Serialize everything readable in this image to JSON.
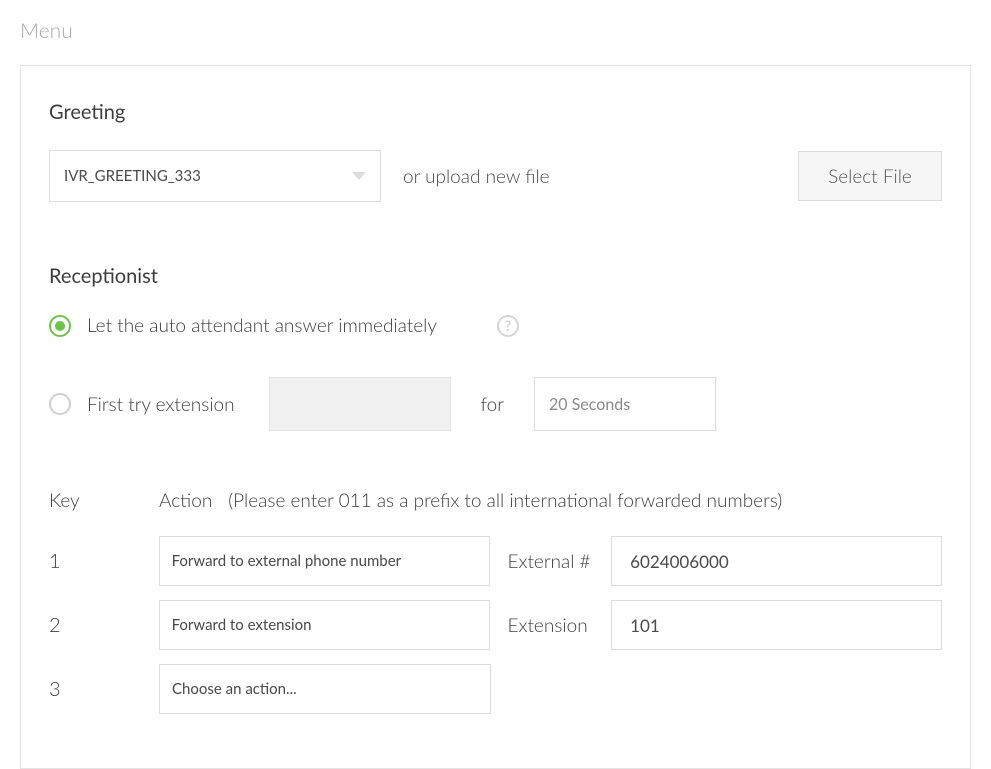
{
  "page_title": "Menu",
  "greeting": {
    "label": "Greeting",
    "selected": "IVR_GREETING_333",
    "upload_hint": "or upload new file",
    "select_file_label": "Select File"
  },
  "receptionist": {
    "label": "Receptionist",
    "option_auto": "Let the auto attendant answer immediately",
    "option_try_ext": "First try extension",
    "for_label": "for",
    "duration_selected": "20 Seconds",
    "help_glyph": "?"
  },
  "keys_section": {
    "key_header": "Key",
    "action_header": "Action",
    "hint": "(Please enter 011 as a prefix to all international forwarded numbers)",
    "rows": [
      {
        "key": "1",
        "action": "Forward to external phone number",
        "value_label": "External #",
        "value": "6024006000"
      },
      {
        "key": "2",
        "action": "Forward to extension",
        "value_label": "Extension",
        "value": "101"
      },
      {
        "key": "3",
        "action": "Choose an action...",
        "value_label": "",
        "value": ""
      }
    ]
  }
}
